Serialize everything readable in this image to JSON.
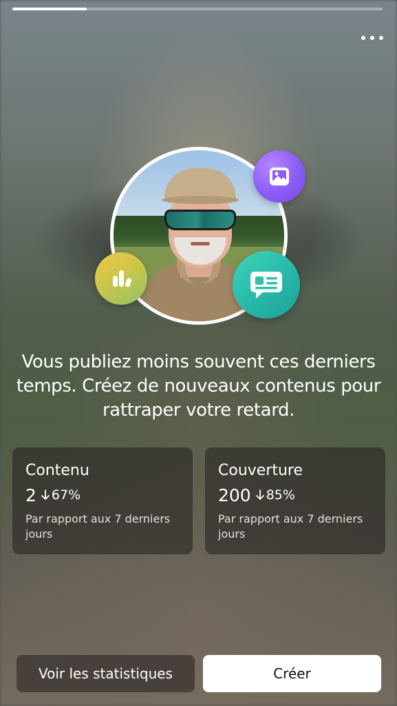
{
  "progress": {
    "fraction": 0.2
  },
  "header": {
    "more_icon": "more-horizontal-icon"
  },
  "hero": {
    "avatar_icon": "profile-avatar",
    "bubbles": [
      {
        "icon": "photo-icon",
        "color": "#8b5cf6"
      },
      {
        "icon": "bar-chart-icon",
        "color": "#d6c44a"
      },
      {
        "icon": "message-icon",
        "color": "#2fc1ad"
      }
    ]
  },
  "headline": "Vous publiez moins souvent ces derniers temps. Créez de nouveaux contenus pour rattraper votre retard.",
  "cards": [
    {
      "title": "Contenu",
      "value": "2",
      "change": "67%",
      "trend": "down",
      "note": "Par rapport aux 7 derniers jours"
    },
    {
      "title": "Couverture",
      "value": "200",
      "change": "85%",
      "trend": "down",
      "note": "Par rapport aux 7 derniers jours"
    }
  ],
  "buttons": {
    "stats": "Voir les statistiques",
    "create": "Créer"
  }
}
